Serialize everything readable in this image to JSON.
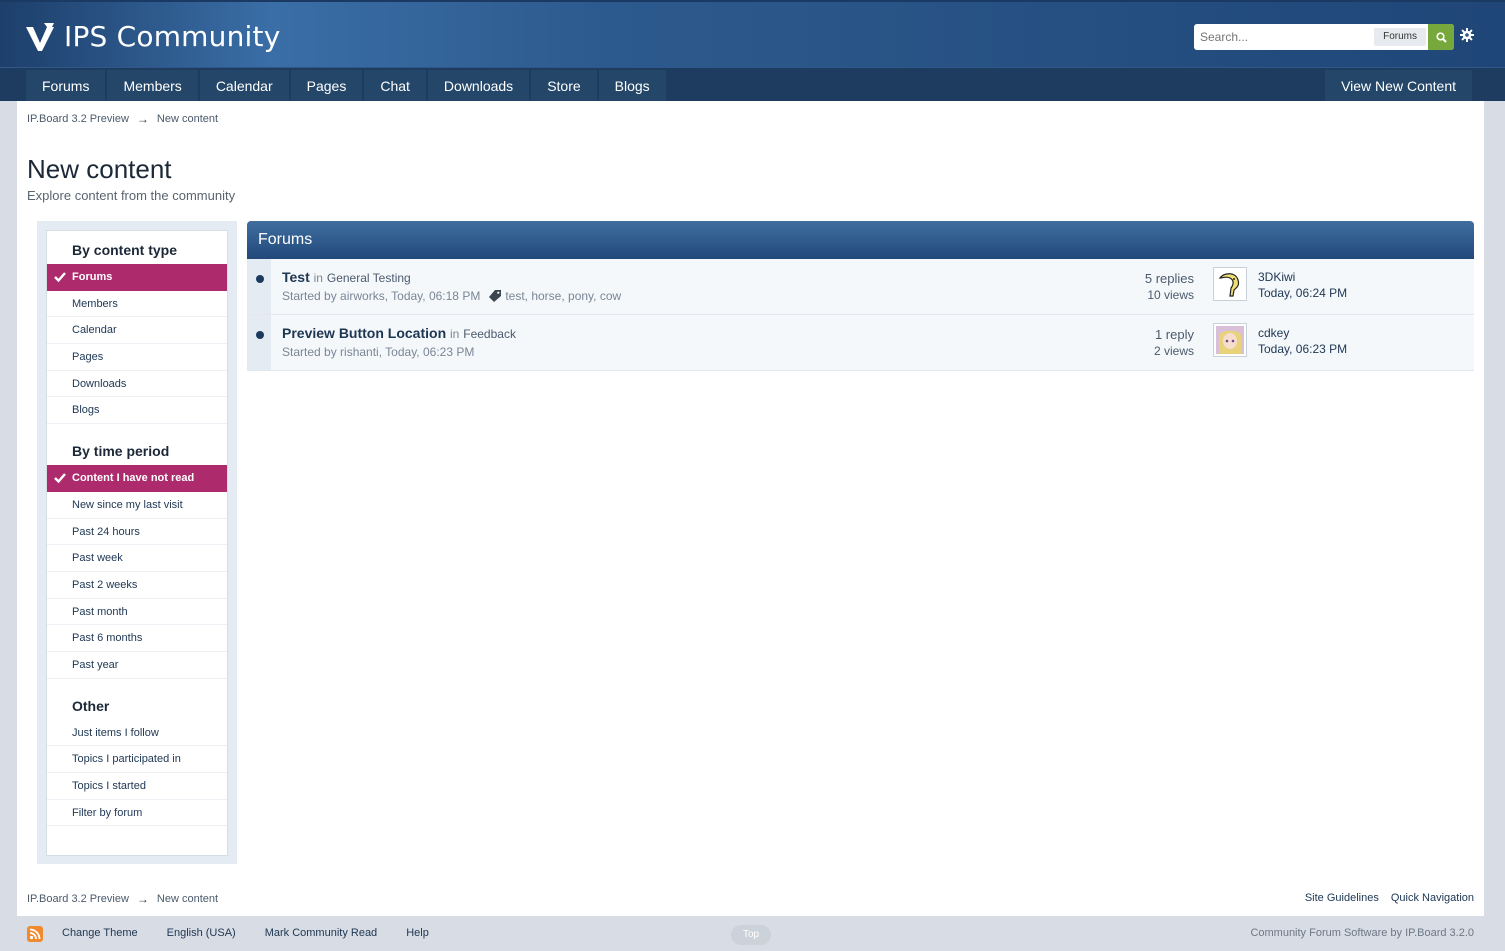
{
  "header": {
    "brand": "IPS Community",
    "search_placeholder": "Search...",
    "search_scope": "Forums"
  },
  "nav": {
    "tabs": [
      "Forums",
      "Members",
      "Calendar",
      "Pages",
      "Chat",
      "Downloads",
      "Store",
      "Blogs"
    ],
    "view_new_content": "View New Content"
  },
  "breadcrumb": {
    "root": "IP.Board 3.2 Preview",
    "separator": "→",
    "current": "New content"
  },
  "page": {
    "title": "New content",
    "description": "Explore content from the community"
  },
  "sidebar": {
    "content_type": {
      "heading": "By content type",
      "items": [
        "Forums",
        "Members",
        "Calendar",
        "Pages",
        "Downloads",
        "Blogs"
      ]
    },
    "time_period": {
      "heading": "By time period",
      "items": [
        "Content I have not read",
        "New since my last visit",
        "Past 24 hours",
        "Past week",
        "Past 2 weeks",
        "Past month",
        "Past 6 months",
        "Past year"
      ]
    },
    "other": {
      "heading": "Other",
      "items": [
        "Just items I follow",
        "Topics I participated in",
        "Topics I started",
        "Filter by forum"
      ]
    }
  },
  "results": {
    "heading": "Forums",
    "topics": [
      {
        "title": "Test",
        "in": "in",
        "forum": "General Testing",
        "started": "Started by airworks, Today, 06:18 PM",
        "tags": "test, horse, pony, cow",
        "replies": "5 replies",
        "views": "10 views",
        "last_poster": "3DKiwi",
        "last_time": "Today, 06:24 PM"
      },
      {
        "title": "Preview Button Location",
        "in": "in",
        "forum": "Feedback",
        "started": "Started by rishanti, Today, 06:23 PM",
        "tags": "",
        "replies": "1 reply",
        "views": "2 views",
        "last_poster": "cdkey",
        "last_time": "Today, 06:23 PM"
      }
    ]
  },
  "footer_links": {
    "guidelines": "Site Guidelines",
    "quick_nav": "Quick Navigation"
  },
  "footer": {
    "links": [
      "Change Theme",
      "English (USA)",
      "Mark Community Read",
      "Help"
    ],
    "top": "Top",
    "copyright": "Community Forum Software by IP.Board 3.2.0"
  },
  "colors": {
    "accent": "#ad2a6d",
    "header": "#2d5a8e",
    "nav": "#1e3c5f",
    "search_button": "#77a83b"
  }
}
